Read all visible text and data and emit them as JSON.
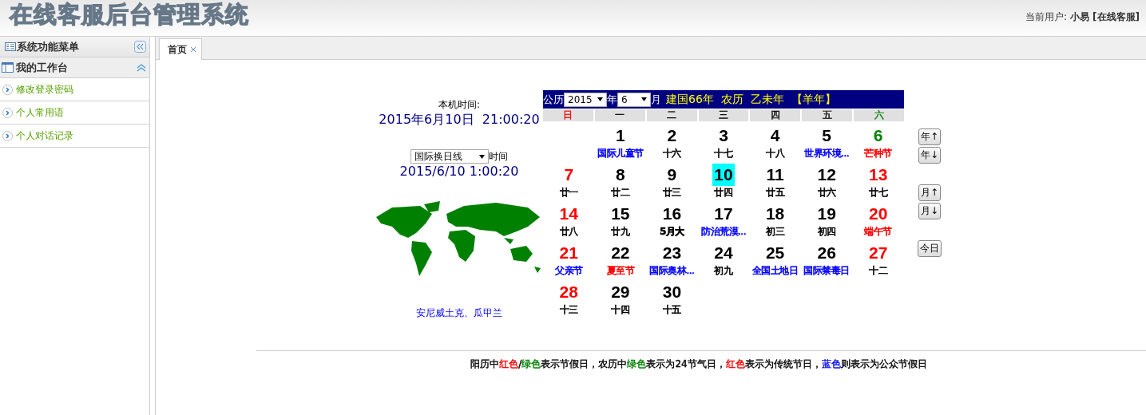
{
  "header": {
    "title": "在线客服后台管理系统",
    "user_label": "当前用户:",
    "user_name": "小易",
    "user_role": "[在线客服]"
  },
  "sidebar": {
    "title": "系统功能菜单",
    "section": {
      "title": "我的工作台",
      "expanded": true,
      "items": [
        {
          "label": "修改登录密码"
        },
        {
          "label": "个人常用语"
        },
        {
          "label": "个人对话记录"
        }
      ]
    }
  },
  "tabs": [
    {
      "label": "首页",
      "selected": true
    }
  ],
  "clock": {
    "local_label": "本机时间:",
    "local_time": "2015年6月10日  21:00:20",
    "zone_select": "国际换日线",
    "zone_suffix": "时间",
    "zone_time": "2015/6/10 1:00:20",
    "zone_places": "安尼威土克、瓜甲兰"
  },
  "calendar": {
    "solar_label": "公历",
    "year": "2015",
    "year_label": "年",
    "month": "6",
    "month_label": "月",
    "info": "建国66年  农历  乙未年  【羊年】",
    "weekdays": [
      {
        "label": "日",
        "color": "#ff0000"
      },
      {
        "label": "一"
      },
      {
        "label": "二"
      },
      {
        "label": "三"
      },
      {
        "label": "四"
      },
      {
        "label": "五"
      },
      {
        "label": "六",
        "color": "#008000"
      }
    ],
    "weeks": [
      [
        {
          "kind": "blank"
        },
        {
          "kind": "day",
          "day": "1",
          "color": "#000000",
          "note": {
            "text": "国际儿童节",
            "color": "#0000ff"
          },
          "selected": false
        },
        {
          "kind": "day",
          "day": "2",
          "color": "#000000",
          "note": {
            "text": "十六"
          },
          "selected": false
        },
        {
          "kind": "day",
          "day": "3",
          "color": "#000000",
          "note": {
            "text": "十七"
          },
          "selected": false
        },
        {
          "kind": "day",
          "day": "4",
          "color": "#000000",
          "note": {
            "text": "十八"
          },
          "selected": false
        },
        {
          "kind": "day",
          "day": "5",
          "color": "#000000",
          "note": {
            "text": "世界环境...",
            "color": "#0000ff"
          },
          "selected": false
        },
        {
          "kind": "day",
          "day": "6",
          "color": "#008000",
          "note": {
            "text": "芒种节",
            "color": "#ff0000"
          },
          "selected": false
        }
      ],
      [
        {
          "kind": "day",
          "day": "7",
          "color": "#ff0000",
          "note": {
            "text": "廿一"
          },
          "selected": false
        },
        {
          "kind": "day",
          "day": "8",
          "color": "#000000",
          "note": {
            "text": "廿二"
          },
          "selected": false
        },
        {
          "kind": "day",
          "day": "9",
          "color": "#000000",
          "note": {
            "text": "廿三"
          },
          "selected": false
        },
        {
          "kind": "day",
          "day": "10",
          "color": "#000000",
          "note": {
            "text": "廿四"
          },
          "selected": true
        },
        {
          "kind": "day",
          "day": "11",
          "color": "#000000",
          "note": {
            "text": "廿五"
          },
          "selected": false
        },
        {
          "kind": "day",
          "day": "12",
          "color": "#000000",
          "note": {
            "text": "廿六"
          },
          "selected": false
        },
        {
          "kind": "day",
          "day": "13",
          "color": "#ff0000",
          "note": {
            "text": "廿七"
          },
          "selected": false
        }
      ],
      [
        {
          "kind": "day",
          "day": "14",
          "color": "#ff0000",
          "note": {
            "text": "廿八"
          },
          "selected": false
        },
        {
          "kind": "day",
          "day": "15",
          "color": "#000000",
          "note": {
            "text": "廿九"
          },
          "selected": false
        },
        {
          "kind": "day",
          "day": "16",
          "color": "#000000",
          "note": {
            "text": "5月大",
            "bold": true
          },
          "selected": false
        },
        {
          "kind": "day",
          "day": "17",
          "color": "#000000",
          "note": {
            "text": "防治荒漠...",
            "color": "#0000ff"
          },
          "selected": false
        },
        {
          "kind": "day",
          "day": "18",
          "color": "#000000",
          "note": {
            "text": "初三"
          },
          "selected": false
        },
        {
          "kind": "day",
          "day": "19",
          "color": "#000000",
          "note": {
            "text": "初四"
          },
          "selected": false
        },
        {
          "kind": "day",
          "day": "20",
          "color": "#ff0000",
          "note": {
            "text": "端午节",
            "color": "#ff0000"
          },
          "selected": false
        }
      ],
      [
        {
          "kind": "day",
          "day": "21",
          "color": "#ff0000",
          "note": {
            "text": "父亲节",
            "color": "#0000ff"
          },
          "selected": false
        },
        {
          "kind": "day",
          "day": "22",
          "color": "#000000",
          "note": {
            "text": "夏至节",
            "color": "#ff0000"
          },
          "selected": false
        },
        {
          "kind": "day",
          "day": "23",
          "color": "#000000",
          "note": {
            "text": "国际奥林...",
            "color": "#0000ff"
          },
          "selected": false
        },
        {
          "kind": "day",
          "day": "24",
          "color": "#000000",
          "note": {
            "text": "初九"
          },
          "selected": false
        },
        {
          "kind": "day",
          "day": "25",
          "color": "#000000",
          "note": {
            "text": "全国土地日",
            "color": "#0000ff"
          },
          "selected": false
        },
        {
          "kind": "day",
          "day": "26",
          "color": "#000000",
          "note": {
            "text": "国际禁毒日",
            "color": "#0000ff"
          },
          "selected": false
        },
        {
          "kind": "day",
          "day": "27",
          "color": "#ff0000",
          "note": {
            "text": "十二"
          },
          "selected": false
        }
      ],
      [
        {
          "kind": "day",
          "day": "28",
          "color": "#ff0000",
          "note": {
            "text": "十三"
          },
          "selected": false
        },
        {
          "kind": "day",
          "day": "29",
          "color": "#000000",
          "note": {
            "text": "十四"
          },
          "selected": false
        },
        {
          "kind": "day",
          "day": "30",
          "color": "#000000",
          "note": {
            "text": "十五"
          },
          "selected": false
        },
        {
          "kind": "blank"
        },
        {
          "kind": "blank"
        },
        {
          "kind": "blank"
        },
        {
          "kind": "blank"
        }
      ]
    ],
    "nav_groups": [
      [
        {
          "label": "年↑"
        },
        {
          "label": "年↓"
        }
      ],
      [
        {
          "label": "月↑"
        },
        {
          "label": "月↓"
        }
      ],
      [
        {
          "label": "今日"
        }
      ]
    ]
  },
  "legend": [
    {
      "text": "阳历中"
    },
    {
      "text": "红色",
      "color": "#ff0000"
    },
    {
      "text": "/"
    },
    {
      "text": "绿色",
      "color": "#008000"
    },
    {
      "text": "表示节假日，农历中"
    },
    {
      "text": "绿色",
      "color": "#008000"
    },
    {
      "text": "表示为24节气日，"
    },
    {
      "text": "红色",
      "color": "#ff0000"
    },
    {
      "text": "表示为传统节日，"
    },
    {
      "text": "蓝色",
      "color": "#0000ff"
    },
    {
      "text": "则表示为公众节假日"
    }
  ]
}
